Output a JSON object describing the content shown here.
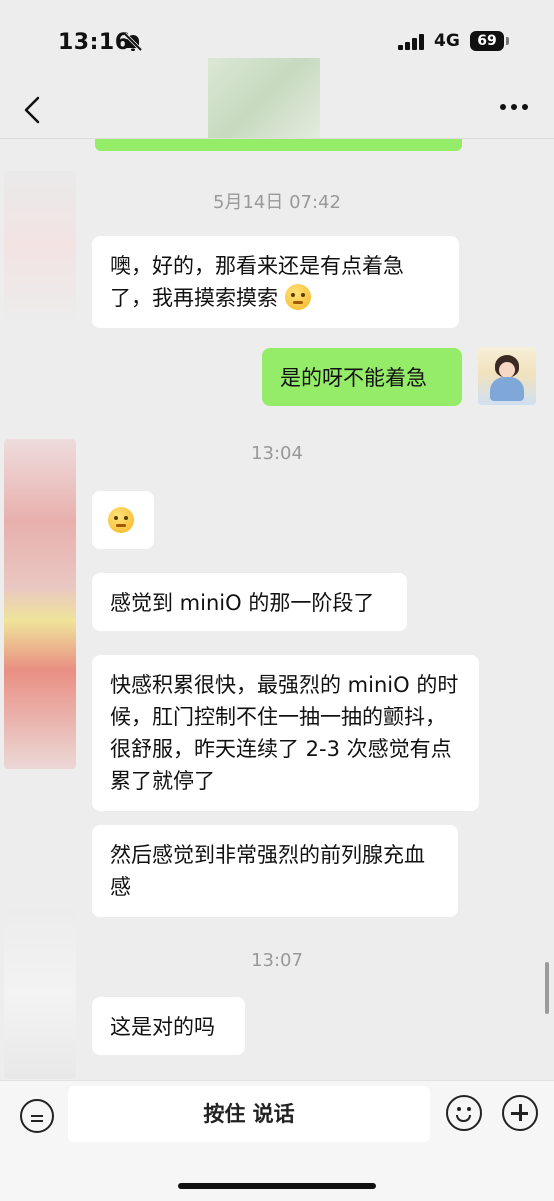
{
  "status_bar": {
    "time": "13:16",
    "network": "4G",
    "battery": "69"
  },
  "nav": {
    "back_icon": "chevron-left-icon",
    "more_icon": "more-dots-icon"
  },
  "messages": [
    {
      "type": "timestamp",
      "text": "5月14日 07:42"
    },
    {
      "type": "bubble",
      "side": "left",
      "text": "噢，好的，那看来还是有点着急了，我再摸索摸索",
      "emoji": "thinking-face-emoji"
    },
    {
      "type": "bubble",
      "side": "right",
      "text": "是的呀不能着急"
    },
    {
      "type": "timestamp",
      "text": "13:04"
    },
    {
      "type": "bubble",
      "side": "left",
      "text": "",
      "emoji": "saluting-face-emoji"
    },
    {
      "type": "bubble",
      "side": "left",
      "text": "感觉到 miniO 的那一阶段了"
    },
    {
      "type": "bubble",
      "side": "left",
      "text": "快感积累很快，最强烈的 miniO 的时候，肛门控制不住一抽一抽的颤抖，很舒服，昨天连续了 2-3 次感觉有点累了就停了"
    },
    {
      "type": "bubble",
      "side": "left",
      "text": "然后感觉到非常强烈的前列腺充血感"
    },
    {
      "type": "timestamp",
      "text": "13:07"
    },
    {
      "type": "bubble",
      "side": "left",
      "text": "这是对的吗"
    }
  ],
  "input_bar": {
    "hold_to_talk": "按住 说话",
    "voice_icon": "voice-mode-icon",
    "emoji_icon": "smiley-icon",
    "plus_icon": "plus-circle-icon"
  },
  "colors": {
    "my_bubble": "#95ec69",
    "their_bubble": "#ffffff",
    "background": "#ededed",
    "timestamp": "#999999"
  }
}
